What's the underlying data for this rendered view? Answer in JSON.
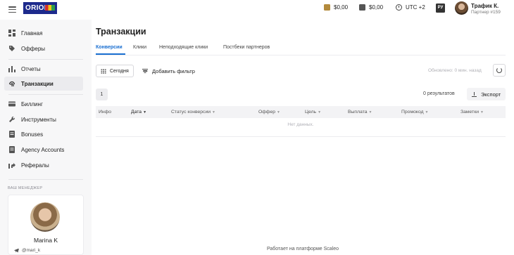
{
  "header": {
    "logo_text": "ORION",
    "balance_1": "$0,00",
    "balance_2": "$0,00",
    "timezone": "UTC +2",
    "language": "РУ",
    "user_name": "Трафик К.",
    "user_partner": "Партнер #159"
  },
  "sidebar": {
    "items": [
      {
        "label": "Главная",
        "icon": "dashboard-icon"
      },
      {
        "label": "Офферы",
        "icon": "tag-icon"
      },
      {
        "label": "Отчеты",
        "icon": "bar-chart-icon"
      },
      {
        "label": "Транзакции",
        "icon": "fingerprint-icon"
      },
      {
        "label": "Биллинг",
        "icon": "credit-card-icon"
      },
      {
        "label": "Инструменты",
        "icon": "wrench-icon"
      },
      {
        "label": "Bonuses",
        "icon": "document-icon"
      },
      {
        "label": "Agency Accounts",
        "icon": "document-icon"
      },
      {
        "label": "Рефералы",
        "icon": "referral-icon"
      }
    ],
    "manager_title": "ВАШ МЕНЕДЖЕР",
    "manager_name": "Marina K",
    "manager_telegram": "@mari_k"
  },
  "main": {
    "title": "Транзакции",
    "tabs": [
      {
        "label": "Конверсии",
        "active": true
      },
      {
        "label": "Клики",
        "active": false
      },
      {
        "label": "Неподходящие клики",
        "active": false
      },
      {
        "label": "Постбеки партнеров",
        "active": false
      }
    ],
    "date_button": "Сегодня",
    "add_filter": "Добавить фильтр",
    "updated_text": "Обновлено: 0 мин. назад",
    "page_number": "1",
    "results_text": "0  результатов",
    "export_label": "Экспорт",
    "columns": [
      "Инфо",
      "Дата",
      "Статус конверсии",
      "Оффер",
      "Цель",
      "Выплата",
      "Промокод",
      "Заметки"
    ],
    "empty_text": "Нет данных."
  },
  "footer": {
    "text": "Работает на платформе Scaleo"
  },
  "colors": {
    "accent": "#1a6fd1",
    "logo_bg": "#1d2a8c"
  }
}
